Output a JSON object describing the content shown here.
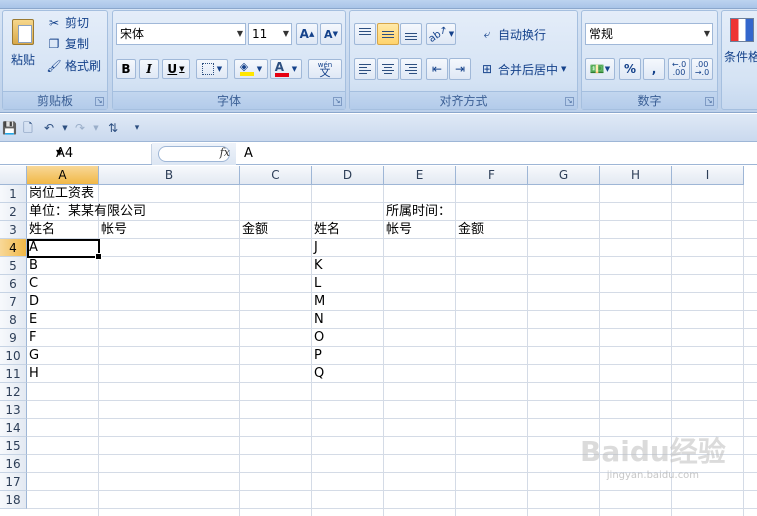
{
  "ribbon": {
    "clipboard": {
      "label": "剪贴板",
      "paste": "粘贴",
      "cut": "剪切",
      "copy": "复制",
      "format_painter": "格式刷"
    },
    "font": {
      "label": "字体",
      "font_name": "宋体",
      "font_size": "11",
      "grow": "A",
      "shrink": "A",
      "bold": "B",
      "italic": "I",
      "underline": "U",
      "font_color_glyph": "A",
      "phonetic": "wén"
    },
    "alignment": {
      "label": "对齐方式",
      "wrap_text": "自动换行",
      "merge_center": "合并后居中"
    },
    "number": {
      "label": "数字",
      "format": "常规",
      "percent": "%",
      "comma": ",",
      "inc_decimal": ".00",
      "dec_decimal": ".00"
    },
    "styles": {
      "conditional": "条件格"
    }
  },
  "formula_bar": {
    "name_box": "A4",
    "fx": "fx",
    "content": "A"
  },
  "grid": {
    "columns": [
      "A",
      "B",
      "C",
      "D",
      "E",
      "F",
      "G",
      "H",
      "I"
    ],
    "selected_column": "A",
    "rows": [
      "1",
      "2",
      "3",
      "4",
      "5",
      "6",
      "7",
      "8",
      "9",
      "10",
      "11",
      "12",
      "13",
      "14",
      "15",
      "16",
      "17",
      "18"
    ],
    "selected_row": "4",
    "cells": {
      "A1": "岗位工资表",
      "A2": "单位：某某有限公司",
      "E2": "所属时间：",
      "A3": "姓名",
      "B3": "帐号",
      "C3": "金额",
      "D3": "姓名",
      "E3": "帐号",
      "F3": "金额",
      "A4": "A",
      "A5": "B",
      "A6": "C",
      "A7": "D",
      "A8": "E",
      "A9": "F",
      "A10": "G",
      "A11": "H",
      "D4": "J",
      "D5": "K",
      "D6": "L",
      "D7": "M",
      "D8": "N",
      "D9": "O",
      "D10": "P",
      "D11": "Q"
    }
  },
  "watermark": {
    "brand": "Baidu经验",
    "url": "jingyan.baidu.com"
  }
}
